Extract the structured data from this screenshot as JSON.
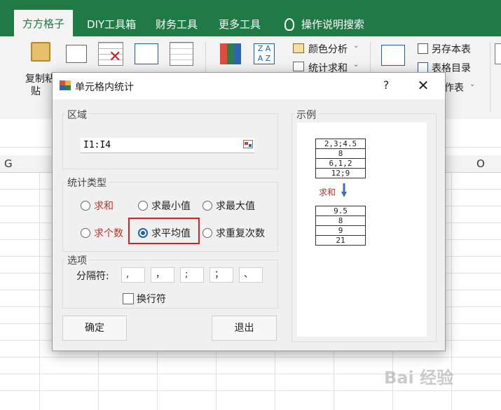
{
  "ribbon": {
    "tabs": [
      "方方格子",
      "DIY工具箱",
      "财务工具",
      "更多工具"
    ],
    "help_search": "操作说明搜索",
    "items": {
      "copy_paste": "复制粘",
      "copy_paste_2": "贴",
      "color_analysis": "颜色分析",
      "sum_stats": "统计求和",
      "save_table": "另存本表",
      "table_toc": "表格目录",
      "sheet_suffix": "作表"
    }
  },
  "columns": [
    "G",
    "O"
  ],
  "dialog": {
    "title": "单元格内统计",
    "help": "?",
    "close": "✕",
    "region_label": "区域",
    "range_value": "I1:I4",
    "stat_type_label": "统计类型",
    "options": [
      {
        "label": "求和",
        "color": "#c0322a",
        "selected": false
      },
      {
        "label": "求最小值",
        "color": "#222222",
        "selected": false
      },
      {
        "label": "求最大值",
        "color": "#222222",
        "selected": false
      },
      {
        "label": "求个数",
        "color": "#c0322a",
        "selected": false
      },
      {
        "label": "求平均值",
        "color": "#222222",
        "selected": true
      },
      {
        "label": "求重复次数",
        "color": "#222222",
        "selected": false
      }
    ],
    "options_label": "选项",
    "separator_label": "分隔符:",
    "separators": [
      ",",
      "，",
      ";",
      "；",
      "、"
    ],
    "newline_label": "换行符",
    "newline_checked": false,
    "ok": "确定",
    "exit": "退出",
    "example_label": "示例",
    "example": {
      "input": [
        "2,3;4.5",
        "8",
        "6,1,2",
        "12;9"
      ],
      "operation": "求和",
      "output": [
        "9.5",
        "8",
        "9",
        "21"
      ]
    }
  },
  "watermark": "Bai 经验"
}
